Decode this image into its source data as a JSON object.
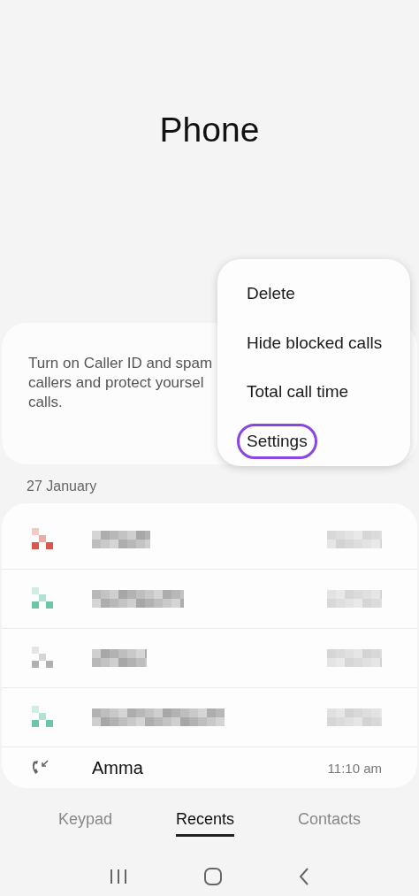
{
  "title": "Phone",
  "banner": {
    "lines": [
      "Turn on Caller ID and spam",
      "callers and protect yoursel",
      "calls."
    ]
  },
  "menu": [
    {
      "label": "Delete",
      "highlighted": false
    },
    {
      "label": "Hide blocked calls",
      "highlighted": false
    },
    {
      "label": "Total call time",
      "highlighted": false
    },
    {
      "label": "Settings",
      "highlighted": true
    }
  ],
  "date_header": "27 January",
  "calls": [
    {
      "kind": "redacted",
      "color": "#d9574f"
    },
    {
      "kind": "redacted",
      "color": "#6cc7a6"
    },
    {
      "kind": "redacted",
      "color": "#b0b0b0"
    },
    {
      "kind": "redacted",
      "color": "#6cc7a6"
    },
    {
      "kind": "call",
      "name": "Amma",
      "time": "11:10 am"
    }
  ],
  "tabs": [
    {
      "label": "Keypad",
      "selected": false
    },
    {
      "label": "Recents",
      "selected": true
    },
    {
      "label": "Contacts",
      "selected": false
    }
  ]
}
